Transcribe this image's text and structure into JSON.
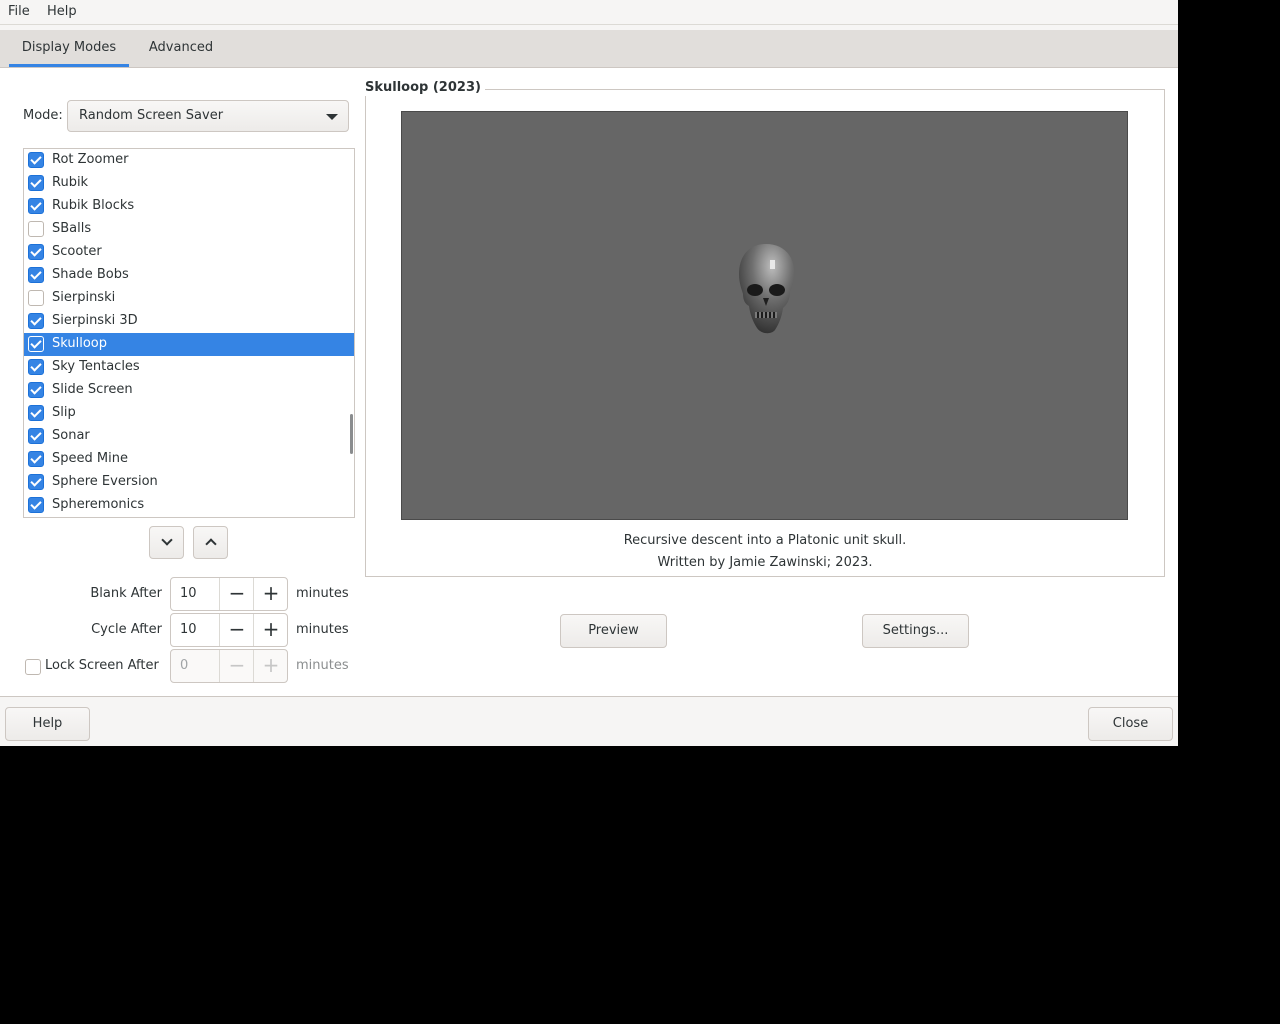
{
  "menu": [
    "File",
    "Help"
  ],
  "tabs": [
    "Display Modes",
    "Advanced"
  ],
  "mode": {
    "label": "Mode:",
    "value": "Random Screen Saver"
  },
  "list": [
    {
      "label": "Rot Zoomer",
      "checked": true
    },
    {
      "label": "Rubik",
      "checked": true
    },
    {
      "label": "Rubik Blocks",
      "checked": true
    },
    {
      "label": "SBalls",
      "checked": false
    },
    {
      "label": "Scooter",
      "checked": true
    },
    {
      "label": "Shade Bobs",
      "checked": true
    },
    {
      "label": "Sierpinski",
      "checked": false
    },
    {
      "label": "Sierpinski 3D",
      "checked": true
    },
    {
      "label": "Skulloop",
      "checked": true,
      "selected": true
    },
    {
      "label": "Sky Tentacles",
      "checked": true
    },
    {
      "label": "Slide Screen",
      "checked": true
    },
    {
      "label": "Slip",
      "checked": true
    },
    {
      "label": "Sonar",
      "checked": true
    },
    {
      "label": "Speed Mine",
      "checked": true
    },
    {
      "label": "Sphere Eversion",
      "checked": true
    },
    {
      "label": "Spheremonics",
      "checked": true
    }
  ],
  "settings": {
    "blank_label": "Blank After",
    "blank_value": "10",
    "cycle_label": "Cycle After",
    "cycle_value": "10",
    "lock_label": "Lock Screen After",
    "lock_value": "0",
    "lock_checked": false,
    "unit": "minutes"
  },
  "preview": {
    "title": "Skulloop (2023)",
    "description": "Recursive descent into a Platonic unit skull.",
    "author": "Written by Jamie Zawinski; 2023.",
    "preview_button": "Preview",
    "settings_button": "Settings..."
  },
  "footer": {
    "help_button": "Help",
    "close_button": "Close"
  },
  "colors": {
    "accent": "#3584e4",
    "preview_bg": "#666666"
  }
}
